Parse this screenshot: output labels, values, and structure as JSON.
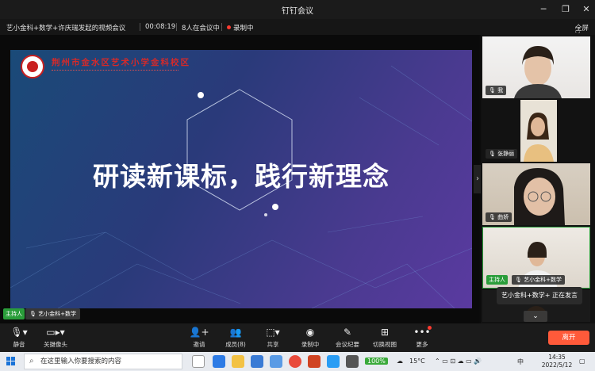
{
  "window": {
    "title": "钉钉会议",
    "minimize": "─",
    "restore": "❐",
    "close": "✕"
  },
  "infobar": {
    "meeting_title": "艺小金科+数学+许庆瑞发起的视频会议",
    "duration": "00:08:19",
    "participants_status": "8人在会议中",
    "recording": "录制中",
    "fullscreen": "全屏"
  },
  "slide": {
    "school_name": "荆州市金水区艺术小学金科校区",
    "title": "研读新课标，践行新理念"
  },
  "stage": {
    "host_badge": "主持人",
    "host_name": "艺小金科+数学"
  },
  "participants": [
    {
      "name": "我"
    },
    {
      "name": "张静丽"
    },
    {
      "name": "曲娇"
    },
    {
      "name": "艺小金科+数学",
      "host_badge": "主持人"
    }
  ],
  "speaking_tooltip": "艺小金科+数学+ 正在发言",
  "toolbar": {
    "mute": "静音",
    "camera_off": "关摄像头",
    "invite": "邀请",
    "members": "成员(8)",
    "share": "共享",
    "recording": "录制中",
    "minutes": "会议纪要",
    "switch_view": "切换视图",
    "more": "更多",
    "leave": "离开"
  },
  "taskbar": {
    "search_placeholder": "在这里输入你要搜索的内容",
    "battery": "100%",
    "weather": "15°C",
    "ime": "中",
    "time": "14:35",
    "date": "2022/5/12"
  },
  "colors": {
    "host_green": "#2a9d3a",
    "leave_orange": "#ff5a3a",
    "record_red": "#ff3b30"
  }
}
